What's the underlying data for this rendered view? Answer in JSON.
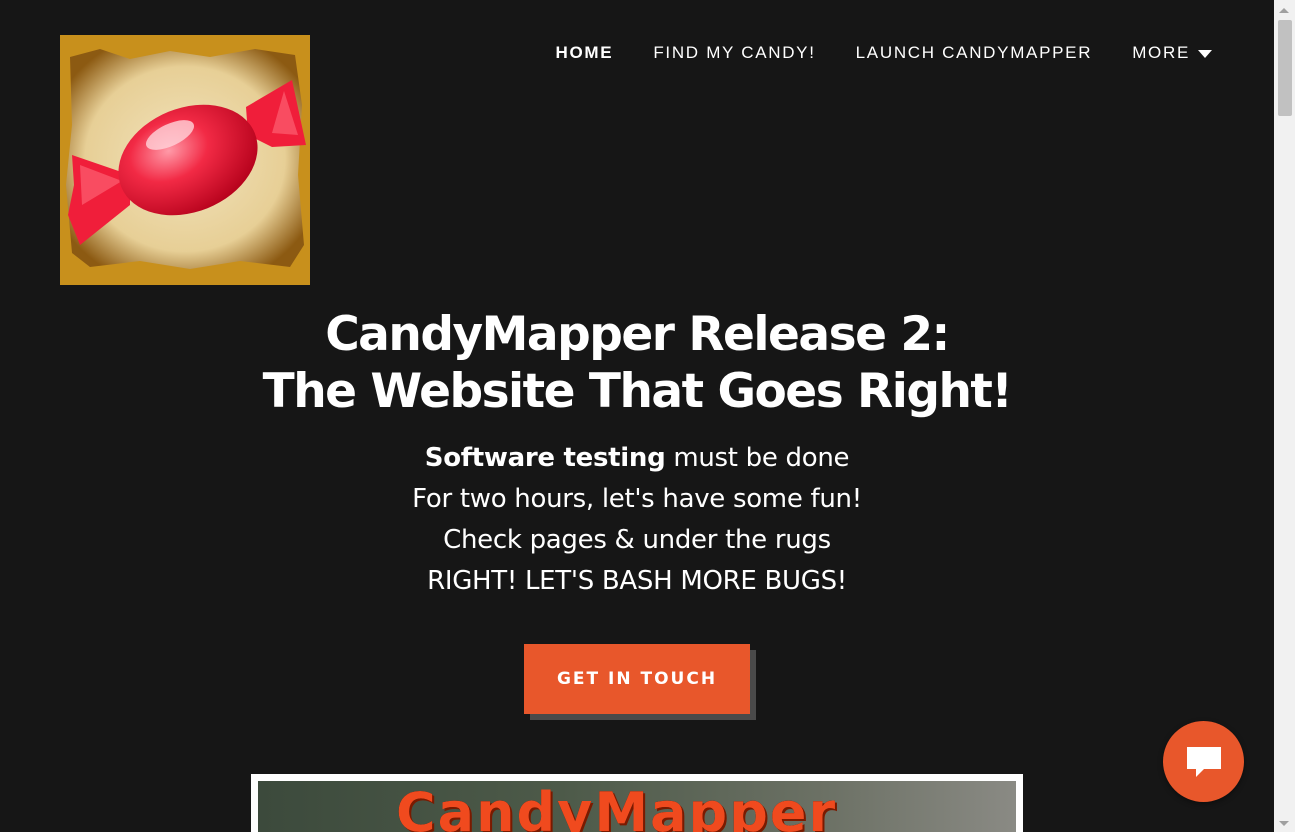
{
  "nav": {
    "items": [
      {
        "label": "HOME",
        "active": true
      },
      {
        "label": "FIND MY CANDY!"
      },
      {
        "label": "LAUNCH CANDYMAPPER"
      }
    ],
    "more_label": "MORE"
  },
  "hero": {
    "title_line1": "CandyMapper Release 2:",
    "title_line2": "The Website That Goes Right!",
    "poem_line1_bold": "Software testing",
    "poem_line1_rest": " must be done",
    "poem_line2": "For two hours, let's have some fun!",
    "poem_line3": "Check pages & under the rugs",
    "poem_line4": "RIGHT! LET'S BASH MORE BUGS!"
  },
  "cta": {
    "label": "GET IN TOUCH"
  },
  "banner": {
    "title": "CandyMapper"
  },
  "colors": {
    "accent": "#e8572b",
    "background": "#161616",
    "text": "#ffffff"
  },
  "icons": {
    "logo": "candy-logo-icon",
    "chat": "chat-bubble-icon",
    "more": "caret-down-icon"
  }
}
